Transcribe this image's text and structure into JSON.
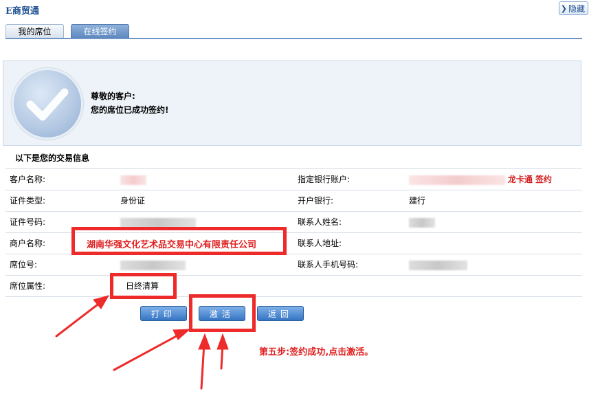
{
  "header": {
    "brand": "E商贸通",
    "hide_label": "隐藏",
    "hide_icon": "chevron-right-icon"
  },
  "tabs": [
    {
      "label": "我的席位",
      "active": false
    },
    {
      "label": "在线签约",
      "active": true
    }
  ],
  "banner": {
    "icon": "checkmark-icon",
    "line1": "尊敬的客户:",
    "line2": "您的席位已成功签约!"
  },
  "info": {
    "title": "以下是您的交易信息",
    "rows": [
      {
        "label": "客户名称:",
        "value": "",
        "right_label": "指定银行账户:",
        "right_value": "龙卡通  签约"
      },
      {
        "label": "证件类型:",
        "value": "身份证",
        "right_label": "开户银行:",
        "right_value": "建行"
      },
      {
        "label": "证件号码:",
        "value": "",
        "right_label": "联系人姓名:",
        "right_value": ""
      },
      {
        "label": "商户名称:",
        "value": "湖南华强文化艺术品交易中心有限责任公司",
        "right_label": "联系人地址:",
        "right_value": ""
      },
      {
        "label": "席位号:",
        "value": "",
        "right_label": "联系人手机号码:",
        "right_value": ""
      },
      {
        "label": "席位属性:",
        "value": "日终清算",
        "right_label": "",
        "right_value": ""
      }
    ]
  },
  "buttons": {
    "print": "打印",
    "activate": "激活",
    "back": "返回"
  },
  "annotation": {
    "step_text": "第五步:签约成功,点击激活。",
    "highlight_color": "#ee2b2b"
  }
}
